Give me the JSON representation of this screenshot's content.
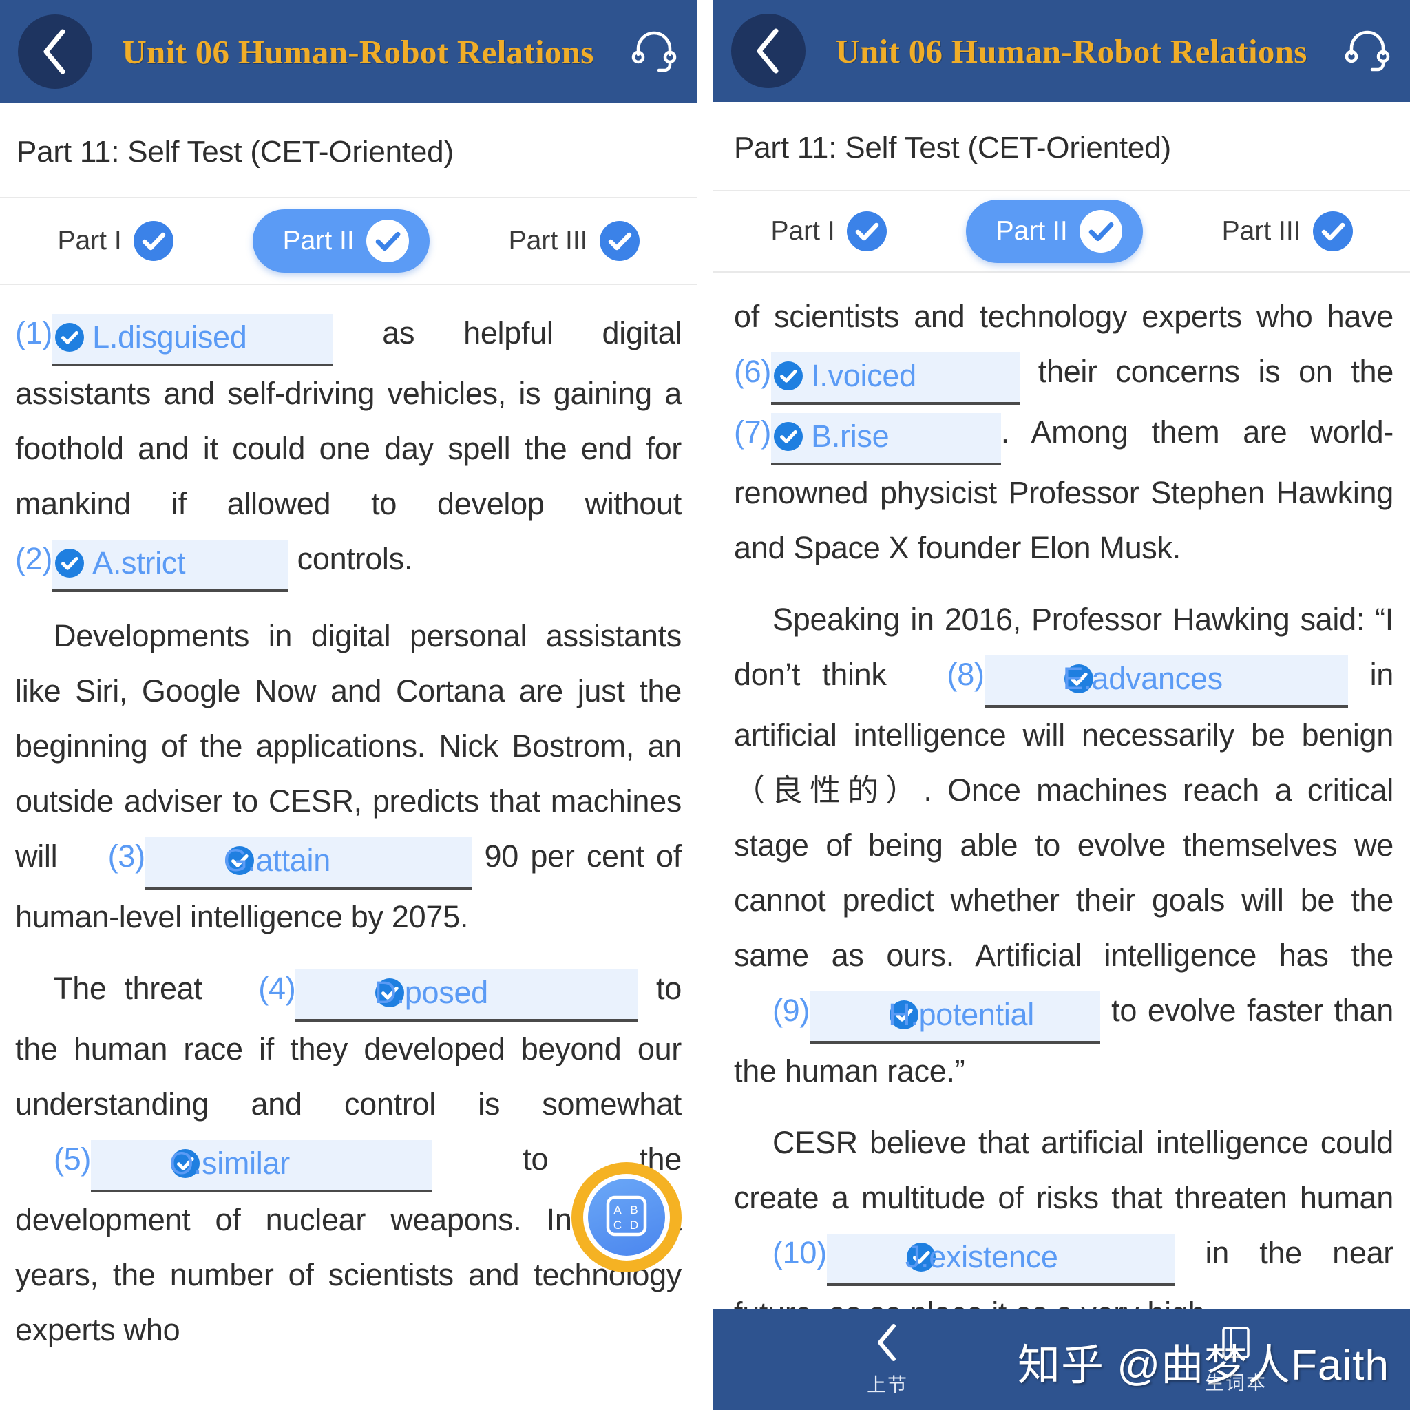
{
  "header": {
    "title": "Unit 06 Human-Robot Relations",
    "back_icon": "chevron-left-icon",
    "audio_icon": "headset-icon"
  },
  "subtitle": "Part 11: Self Test (CET-Oriented)",
  "tabs": [
    {
      "label": "Part I",
      "checked": true,
      "active": false
    },
    {
      "label": "Part II",
      "checked": true,
      "active": true
    },
    {
      "label": "Part III",
      "checked": true,
      "active": false
    }
  ],
  "left_page": {
    "paragraphs": [
      {
        "indent": false,
        "segments": [
          {
            "type": "blank",
            "num": "(1)",
            "answer": "L.disguised",
            "pad": 9
          },
          {
            "type": "text",
            "value": " as helpful digital assistants and self-driving vehicles, is gaining a foothold and it could one day spell the end for mankind if allowed to develop without "
          },
          {
            "type": "blank",
            "num": "(2)",
            "answer": "A.strict",
            "pad": 11
          },
          {
            "type": "text",
            "value": " controls."
          }
        ]
      },
      {
        "indent": true,
        "segments": [
          {
            "type": "text",
            "value": "Developments in digital personal assistants like Siri, Google Now and Cortana are just the beginning of the applications. Nick Bostrom, an outside adviser to CESR, predicts that machines will "
          },
          {
            "type": "blank",
            "num": "(3)",
            "answer": "G.attain",
            "pad": 11
          },
          {
            "type": "text",
            "value": " 90 per cent of human-level intelligence by 2075."
          }
        ]
      },
      {
        "indent": true,
        "segments": [
          {
            "type": "text",
            "value": "The threat "
          },
          {
            "type": "blank",
            "num": "(4)",
            "answer": "D.posed",
            "pad": 12
          },
          {
            "type": "text",
            "value": " to the human race if they developed beyond our understanding and control is somewhat "
          },
          {
            "type": "blank",
            "num": "(5)",
            "answer": "O.similar",
            "pad": 11
          },
          {
            "type": "text",
            "value": " to the development of nuclear weapons. In recent years, the number of scientists and technology experts who"
          }
        ]
      }
    ]
  },
  "right_page": {
    "paragraphs": [
      {
        "indent": false,
        "segments": [
          {
            "type": "text",
            "value": "of scientists and technology experts who have "
          },
          {
            "type": "blank",
            "num": "(6)",
            "answer": "I.voiced",
            "pad": 11
          },
          {
            "type": "text",
            "value": " their concerns is on the "
          },
          {
            "type": "blank",
            "num": "(7)",
            "answer": "B.rise",
            "pad": 12
          },
          {
            "type": "text",
            "value": ". Among them are world-renowned physicist Professor Stephen Hawking and Space X founder Elon Musk."
          }
        ]
      },
      {
        "indent": true,
        "segments": [
          {
            "type": "text",
            "value": "Speaking in 2016, Professor Hawking said: “I don’t think "
          },
          {
            "type": "blank",
            "num": "(8)",
            "answer": "E.advances",
            "pad": 9
          },
          {
            "type": "text",
            "value": " in artificial intelligence will necessarily be benign（良性的）. Once machines reach a critical stage of being able to evolve themselves we cannot predict whether their goals will be the same as ours. Artificial intelligence has the "
          },
          {
            "type": "blank",
            "num": "(9)",
            "answer": "H.potential",
            "pad": 2
          },
          {
            "type": "text",
            "value": " to evolve faster than the human race.”"
          }
        ]
      },
      {
        "indent": true,
        "segments": [
          {
            "type": "text",
            "value": "CESR believe that artificial intelligence could create a multitude of risks that threaten human "
          },
          {
            "type": "blank",
            "num": "(10)",
            "answer": "J.existence",
            "pad": 8
          },
          {
            "type": "text",
            "value": " in the near future, as so place it as a very high"
          }
        ]
      }
    ]
  },
  "fab": {
    "icon": "abcd-icon",
    "letters": [
      "A",
      "B",
      "C",
      "D"
    ],
    "ring_color": "#f5b223",
    "button_color": "#4b86ee"
  },
  "bottom_nav": [
    {
      "label": "上节",
      "icon": "chevron-left-icon"
    },
    {
      "label": "生词本",
      "icon": "notebook-icon"
    }
  ],
  "watermark": "知乎 @曲梦人Faith",
  "colors": {
    "header_blue": "#2e538f",
    "title_gold": "#f0ad28",
    "accent_blue": "#5b9bf5",
    "slot_bg": "#eaf2fd",
    "fab_ring": "#f5b223"
  }
}
